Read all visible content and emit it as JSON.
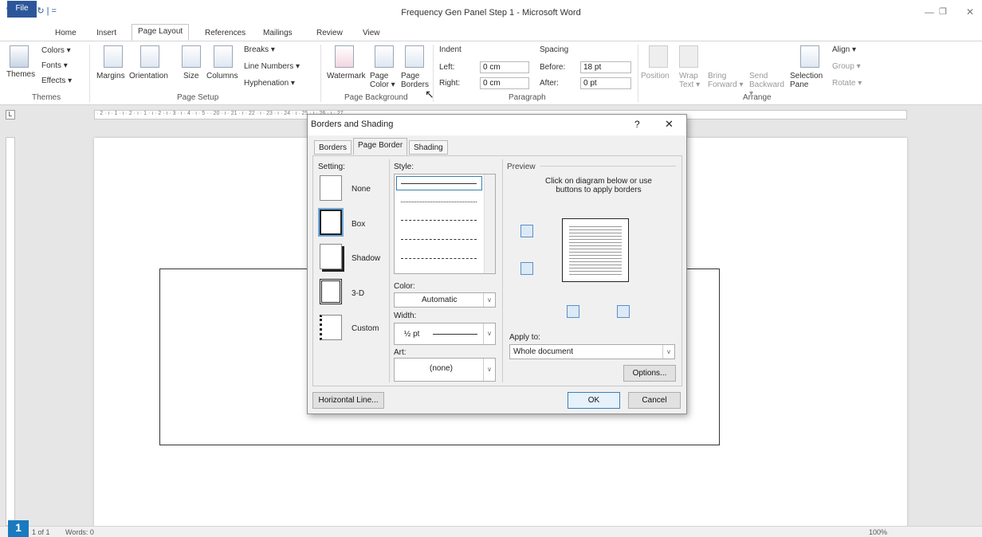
{
  "window": {
    "title": "Frequency Gen Panel Step 1 - Microsoft Word",
    "qat": "W | ↶ - ↻ | ="
  },
  "tabs": [
    "File",
    "Home",
    "Insert",
    "Page Layout",
    "References",
    "Mailings",
    "Review",
    "View"
  ],
  "ribbon": {
    "themes": {
      "label": "Themes",
      "colors": "Colors ▾",
      "fonts": "Fonts ▾",
      "effects": "Effects ▾",
      "group": "Themes"
    },
    "pagesetup": {
      "margins": "Margins",
      "orientation": "Orientation",
      "size": "Size",
      "columns": "Columns",
      "breaks": "Breaks ▾",
      "line_numbers": "Line Numbers ▾",
      "hyphenation": "Hyphenation ▾",
      "group": "Page Setup"
    },
    "background": {
      "watermark": "Watermark",
      "page_color": "Page Color ▾",
      "page_borders": "Page Borders",
      "group": "Page Background"
    },
    "paragraph": {
      "indent": "Indent",
      "left_label": "Left:",
      "left_val": "0 cm",
      "right_label": "Right:",
      "right_val": "0 cm",
      "spacing": "Spacing",
      "before_label": "Before:",
      "before_val": "18 pt",
      "after_label": "After:",
      "after_val": "0 pt",
      "group": "Paragraph"
    },
    "arrange": {
      "position": "Position",
      "wrap": "Wrap Text ▾",
      "bring": "Bring Forward ▾",
      "send": "Send Backward ▾",
      "selection": "Selection Pane",
      "align": "Align ▾",
      "group_btn": "Group ▾",
      "rotate": "Rotate ▾",
      "group": "Arrange"
    }
  },
  "ruler_text": "· 2 · ı · 1 · ı · 2 · ı · 1 · ı · 2 · ı · 3 · ı · 4 · ı · 5 ·                                                                                        · 20 · ı · 21 · ı · 22 · ı · 23 · ı · 24 · ı · 25 · ı · 26 · ı · 27",
  "dialog": {
    "title": "Borders and Shading",
    "help": "?",
    "close": "✕",
    "tabs": [
      "Borders",
      "Page Border",
      "Shading"
    ],
    "setting_label": "Setting:",
    "settings": [
      "None",
      "Box",
      "Shadow",
      "3-D",
      "Custom"
    ],
    "style_label": "Style:",
    "color_label": "Color:",
    "color_value": "Automatic",
    "width_label": "Width:",
    "width_value": "½ pt",
    "art_label": "Art:",
    "art_value": "(none)",
    "preview_label": "Preview",
    "preview_hint": "Click on diagram below or use buttons to apply borders",
    "apply_label": "Apply to:",
    "apply_value": "Whole document",
    "options": "Options...",
    "horizontal_line": "Horizontal Line...",
    "ok": "OK",
    "cancel": "Cancel"
  },
  "status": {
    "page": "1 of 1",
    "words": "Words: 0",
    "zoom": "100%"
  },
  "step_badge": "1"
}
